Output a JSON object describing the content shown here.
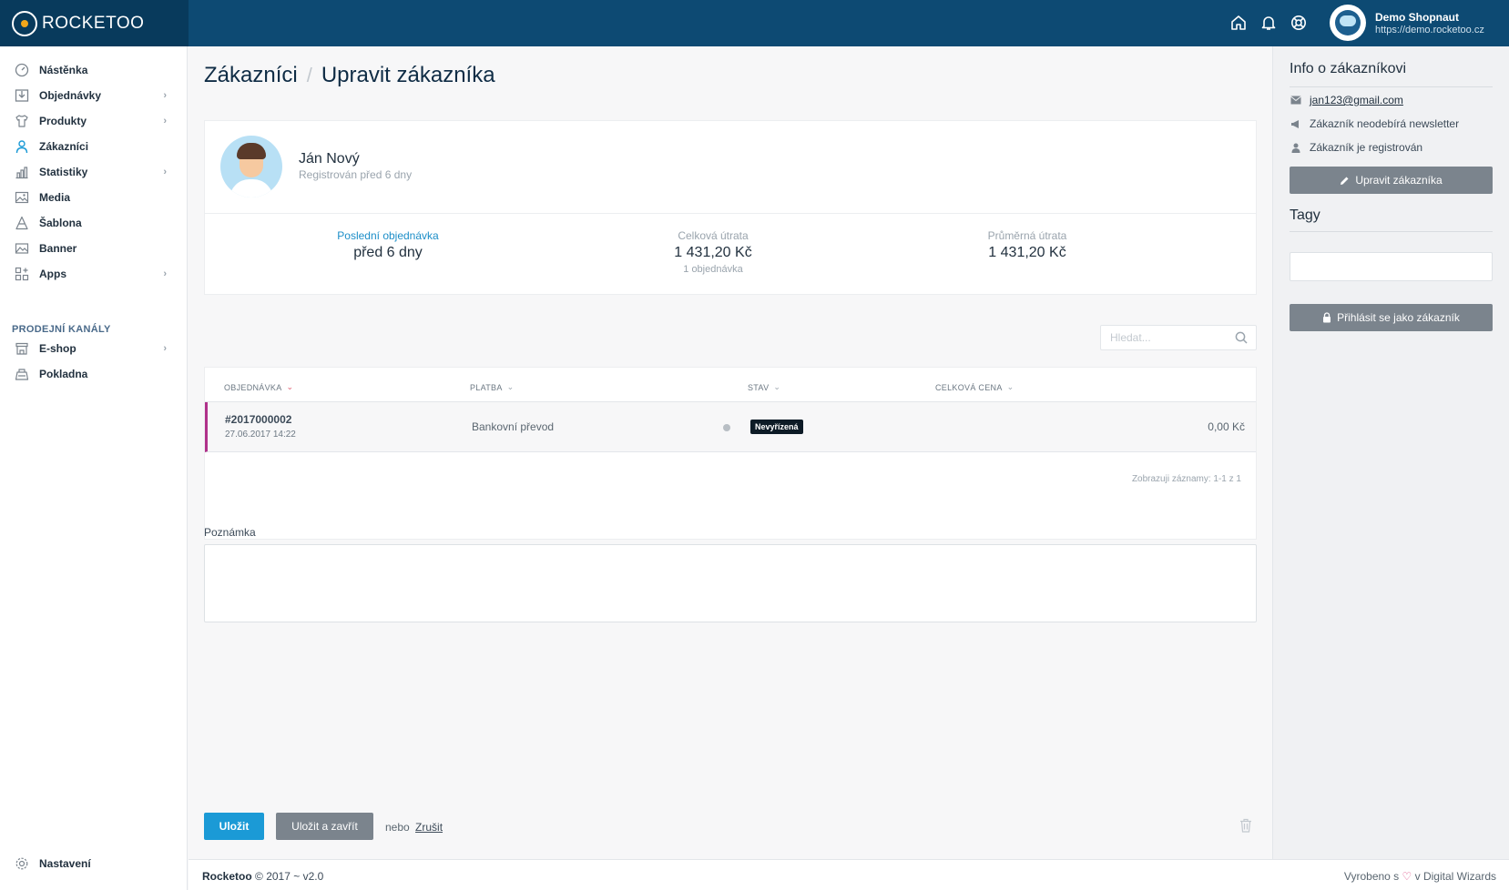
{
  "brand": {
    "name": "ROCKETOO"
  },
  "topbar": {
    "icons": [
      "home-icon",
      "bell-icon",
      "lifebuoy-icon"
    ],
    "user_name": "Demo Shopnaut",
    "user_url": "https://demo.rocketoo.cz"
  },
  "sidebar": {
    "items": [
      {
        "label": "Nástěnka",
        "icon": "dashboard-icon",
        "chevron": false
      },
      {
        "label": "Objednávky",
        "icon": "orders-icon",
        "chevron": true
      },
      {
        "label": "Produkty",
        "icon": "shirt-icon",
        "chevron": true
      },
      {
        "label": "Zákazníci",
        "icon": "user-icon",
        "chevron": false,
        "active": true
      },
      {
        "label": "Statistiky",
        "icon": "stats-icon",
        "chevron": true
      },
      {
        "label": "Media",
        "icon": "image-icon",
        "chevron": false
      },
      {
        "label": "Šablona",
        "icon": "template-icon",
        "chevron": false
      },
      {
        "label": "Banner",
        "icon": "banner-icon",
        "chevron": false
      },
      {
        "label": "Apps",
        "icon": "apps-icon",
        "chevron": true
      }
    ],
    "channels_label": "PRODEJNÍ KANÁLY",
    "channels": [
      {
        "label": "E-shop",
        "icon": "shop-icon",
        "chevron": true
      },
      {
        "label": "Pokladna",
        "icon": "register-icon",
        "chevron": false
      }
    ],
    "settings_label": "Nastavení"
  },
  "breadcrumb": {
    "parent": "Zákazníci",
    "separator": "/",
    "current": "Upravit zákazníka"
  },
  "customer": {
    "name": "Ján Nový",
    "registered": "Registrován před 6 dny",
    "stats": [
      {
        "label": "Poslední objednávka",
        "value": "před 6 dny",
        "sub": ""
      },
      {
        "label": "Celková útrata",
        "value": "1 431,20 Kč",
        "sub": "1 objednávka"
      },
      {
        "label": "Průměrná útrata",
        "value": "1 431,20 Kč",
        "sub": ""
      }
    ]
  },
  "search": {
    "placeholder": "Hledat..."
  },
  "orders_table": {
    "headers": [
      "OBJEDNÁVKA",
      "PLATBA",
      "STAV",
      "CELKOVÁ CENA"
    ],
    "rows": [
      {
        "id": "#2017000002",
        "date": "27.06.2017 14:22",
        "payment": "Bankovní převod",
        "status": "Nevyřízená",
        "price": "0,00 Kč"
      }
    ],
    "records": "Zobrazuji záznamy: 1-1 z 1"
  },
  "note": {
    "label": "Poznámka",
    "value": ""
  },
  "actions": {
    "save": "Uložit",
    "save_close": "Uložit a zavřít",
    "or": "nebo",
    "cancel": "Zrušit"
  },
  "footer": {
    "brand": "Rocketoo",
    "copyright": "© 2017 ~ v2.0",
    "made_prefix": "Vyrobeno s",
    "made_suffix": "v Digital Wizards"
  },
  "info_panel": {
    "title": "Info o zákazníkovi",
    "email": "jan123@gmail.com",
    "newsletter": "Zákazník neodebírá newsletter",
    "registered": "Zákazník je registrován",
    "edit_button": "Upravit zákazníka",
    "tags_title": "Tagy",
    "login_button": "Přihlásit se jako zákazník"
  },
  "colors": {
    "topbar": "#0d4a73",
    "accent": "#1b9ad6",
    "row_marker": "#b0318a",
    "badge": "#0d1b26"
  }
}
